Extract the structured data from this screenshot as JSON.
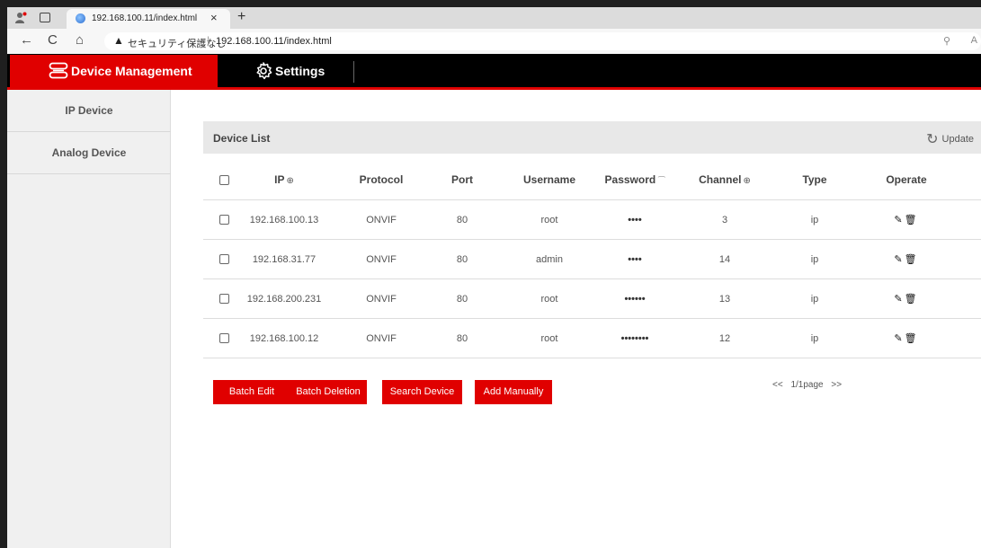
{
  "browser": {
    "tab_title": "192.168.100.11/index.html",
    "tab_close": "×",
    "new_tab": "+",
    "back": "←",
    "reload": "C",
    "home": "⌂",
    "security_warning": "セキュリティ保護なし",
    "separator": "|",
    "url": "192.168.100.11/index.html",
    "right_text": "A"
  },
  "app_nav": {
    "device_management": "Device Management",
    "settings": "Settings"
  },
  "sidebar": {
    "items": [
      {
        "label": "IP Device"
      },
      {
        "label": "Analog Device"
      }
    ]
  },
  "device_list": {
    "title": "Device List",
    "update_label": "Update",
    "columns": {
      "ip": "IP",
      "protocol": "Protocol",
      "port": "Port",
      "username": "Username",
      "password": "Password",
      "channel": "Channel",
      "type": "Type",
      "operate": "Operate"
    },
    "rows": [
      {
        "ip": "192.168.100.13",
        "protocol": "ONVIF",
        "port": "80",
        "username": "root",
        "password": "••••",
        "channel": "3",
        "type": "ip"
      },
      {
        "ip": "192.168.31.77",
        "protocol": "ONVIF",
        "port": "80",
        "username": "admin",
        "password": "••••",
        "channel": "14",
        "type": "ip"
      },
      {
        "ip": "192.168.200.231",
        "protocol": "ONVIF",
        "port": "80",
        "username": "root",
        "password": "••••••",
        "channel": "13",
        "type": "ip"
      },
      {
        "ip": "192.168.100.12",
        "protocol": "ONVIF",
        "port": "80",
        "username": "root",
        "password": "••••••••",
        "channel": "12",
        "type": "ip"
      }
    ]
  },
  "actions": {
    "batch_edit": "Batch Edit",
    "batch_deletion": "Batch Deletion",
    "search_device": "Search Device",
    "add_manually": "Add Manually"
  },
  "pager": {
    "prev": "<<",
    "page": "1/1page",
    "next": ">>"
  },
  "colors": {
    "accent": "#e00000",
    "nav_bg": "#000000",
    "sidebar_bg": "#f0f0f0"
  }
}
